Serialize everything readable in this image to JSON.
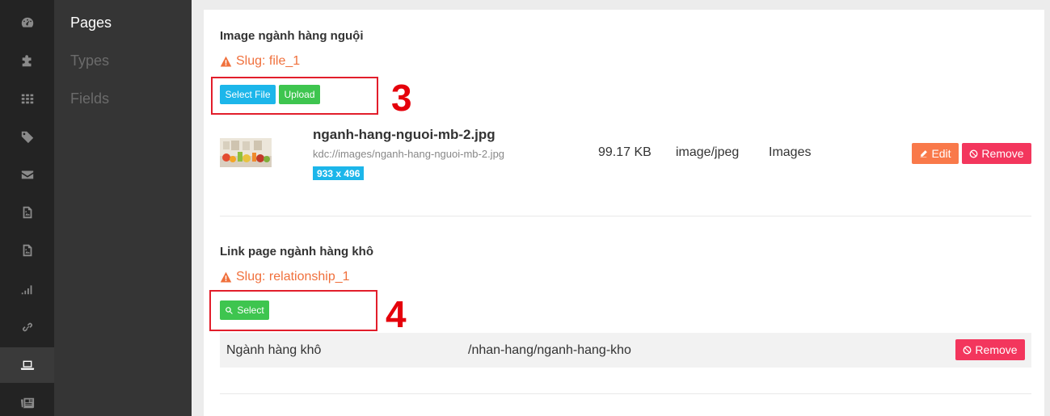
{
  "icon_rail": {
    "items": [
      {
        "icon": "dashboard-icon"
      },
      {
        "icon": "puzzle-icon"
      },
      {
        "icon": "grid-icon"
      },
      {
        "icon": "tag-icon"
      },
      {
        "icon": "envelope-icon"
      },
      {
        "icon": "image-file-icon"
      },
      {
        "icon": "image-file-icon"
      },
      {
        "icon": "signal-icon"
      },
      {
        "icon": "link-icon"
      },
      {
        "icon": "laptop-icon",
        "active": true
      },
      {
        "icon": "newspaper-icon"
      }
    ]
  },
  "subnav": {
    "items": [
      {
        "label": "Pages",
        "active": true
      },
      {
        "label": "Types"
      },
      {
        "label": "Fields"
      }
    ]
  },
  "file_field": {
    "title": "Image ngành hàng nguội",
    "slug": "Slug: file_1",
    "select_file_label": "Select File",
    "upload_label": "Upload",
    "annotation_number": "3",
    "file": {
      "name": "nganh-hang-nguoi-mb-2.jpg",
      "path": "kdc://images/nganh-hang-nguoi-mb-2.jpg",
      "dimensions": "933 x 496",
      "size": "99.17 KB",
      "mime": "image/jpeg",
      "category": "Images",
      "edit_label": "Edit",
      "remove_label": "Remove"
    }
  },
  "relationship_field": {
    "title": "Link page ngành hàng khô",
    "slug": "Slug: relationship_1",
    "select_label": "Select",
    "annotation_number": "4",
    "row": {
      "name": "Ngành hàng khô",
      "path": "/nhan-hang/nganh-hang-kho",
      "remove_label": "Remove"
    }
  },
  "colors": {
    "accent_orange": "#f0703c",
    "button_blue": "#1cb6ea",
    "button_green": "#3ec54f",
    "button_red": "#f3365d",
    "annotation_red": "#e21e2b"
  }
}
